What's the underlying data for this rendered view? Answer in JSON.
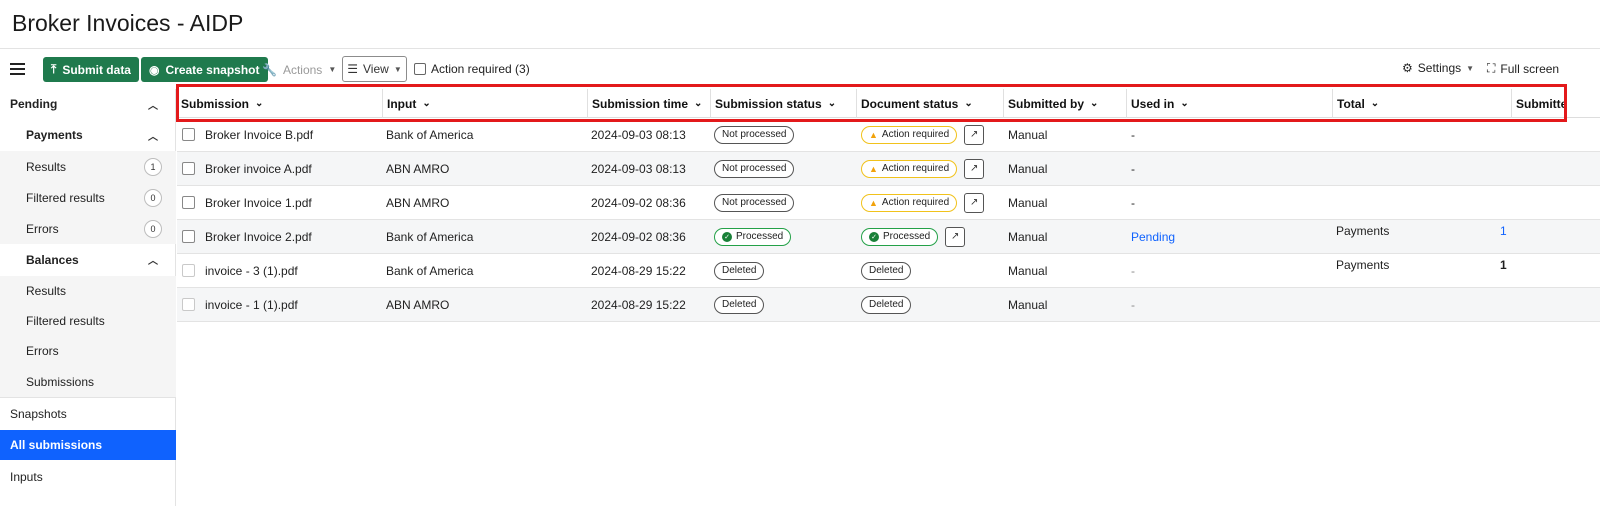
{
  "app": {
    "title": "Broker Invoices - AIDP"
  },
  "toolbar": {
    "submit_label": "Submit data",
    "snapshot_label": "Create snapshot",
    "actions_label": "Actions",
    "view_label": "View",
    "action_required_label": "Action required (3)",
    "settings_label": "Settings",
    "fullscreen_label": "Full screen"
  },
  "sidebar": {
    "pending": "Pending",
    "payments": "Payments",
    "payments_items": [
      {
        "label": "Results",
        "count": "1"
      },
      {
        "label": "Filtered results",
        "count": "0"
      },
      {
        "label": "Errors",
        "count": "0"
      }
    ],
    "balances": "Balances",
    "balances_items": [
      "Results",
      "Filtered results",
      "Errors",
      "Submissions"
    ],
    "snapshots": "Snapshots",
    "all_submissions": "All submissions",
    "inputs": "Inputs"
  },
  "table": {
    "columns": [
      "Submission",
      "Input",
      "Submission time",
      "Submission status",
      "Document status",
      "Submitted by",
      "Used in",
      "Total",
      "Submitte"
    ],
    "rows": [
      {
        "submission": "Broker Invoice B.pdf",
        "input": "Bank of America",
        "time": "2024-09-03 08:13",
        "sub_status": "Not processed",
        "doc_status": "Action required",
        "submitted_by": "Manual",
        "used_in": "-",
        "total_label": "",
        "total_value": ""
      },
      {
        "submission": "Broker invoice A.pdf",
        "input": "ABN AMRO",
        "time": "2024-09-03 08:13",
        "sub_status": "Not processed",
        "doc_status": "Action required",
        "submitted_by": "Manual",
        "used_in": "-",
        "total_label": "",
        "total_value": ""
      },
      {
        "submission": "Broker Invoice 1.pdf",
        "input": "ABN AMRO",
        "time": "2024-09-02 08:36",
        "sub_status": "Not processed",
        "doc_status": "Action required",
        "submitted_by": "Manual",
        "used_in": "-",
        "total_label": "",
        "total_value": ""
      },
      {
        "submission": "Broker Invoice 2.pdf",
        "input": "Bank of America",
        "time": "2024-09-02 08:36",
        "sub_status": "Processed",
        "doc_status": "Processed",
        "submitted_by": "Manual",
        "used_in": "Pending",
        "total_label": "Payments",
        "total_value": "1"
      },
      {
        "submission": "invoice - 3 (1).pdf",
        "input": "Bank of America",
        "time": "2024-08-29 15:22",
        "sub_status": "Deleted",
        "doc_status": "Deleted",
        "submitted_by": "Manual",
        "used_in": "-",
        "total_label": "Payments",
        "total_value": "1"
      },
      {
        "submission": "invoice - 1 (1).pdf",
        "input": "ABN AMRO",
        "time": "2024-08-29 15:22",
        "sub_status": "Deleted",
        "doc_status": "Deleted",
        "submitted_by": "Manual",
        "used_in": "-",
        "total_label": "",
        "total_value": ""
      }
    ]
  },
  "colors": {
    "brand_green": "#1f7a4d",
    "active_blue": "#0f62fe",
    "highlight_red": "#e3191b"
  }
}
